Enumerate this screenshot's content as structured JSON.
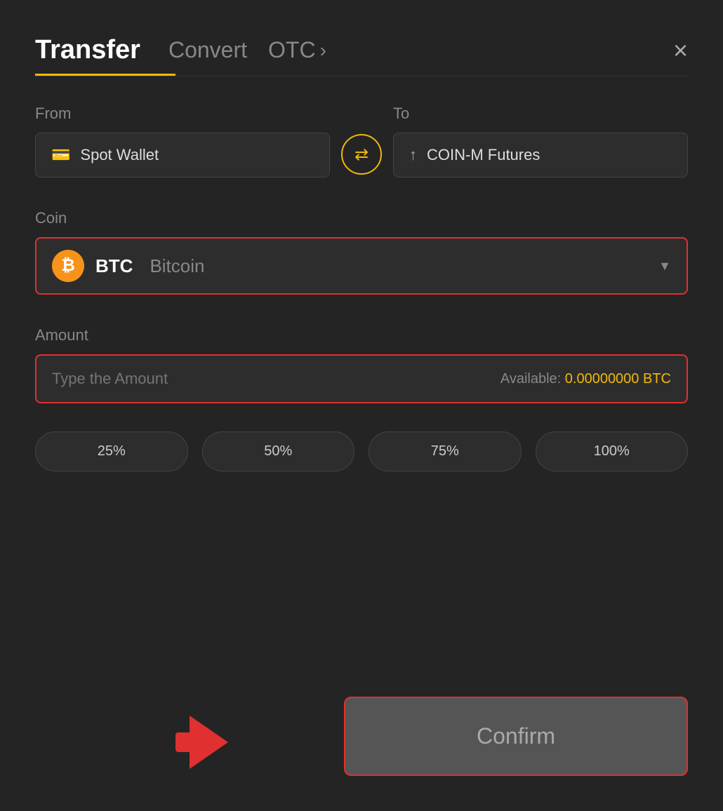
{
  "header": {
    "tab_transfer": "Transfer",
    "tab_convert": "Convert",
    "tab_otc": "OTC",
    "tab_otc_chevron": "›",
    "close_label": "×"
  },
  "from_section": {
    "label": "From",
    "wallet_label": "Spot Wallet",
    "wallet_icon": "💳"
  },
  "to_section": {
    "label": "To",
    "wallet_label": "COIN-M Futures",
    "wallet_icon": "↑"
  },
  "swap": {
    "icon": "⇄"
  },
  "coin_section": {
    "label": "Coin",
    "coin_symbol": "BTC",
    "coin_name": "Bitcoin"
  },
  "amount_section": {
    "label": "Amount",
    "placeholder": "Type the Amount",
    "available_label": "Available: ",
    "available_value": "0.00000000 BTC"
  },
  "pct_buttons": [
    "25%",
    "50%",
    "75%",
    "100%"
  ],
  "confirm_button": {
    "label": "Confirm"
  }
}
